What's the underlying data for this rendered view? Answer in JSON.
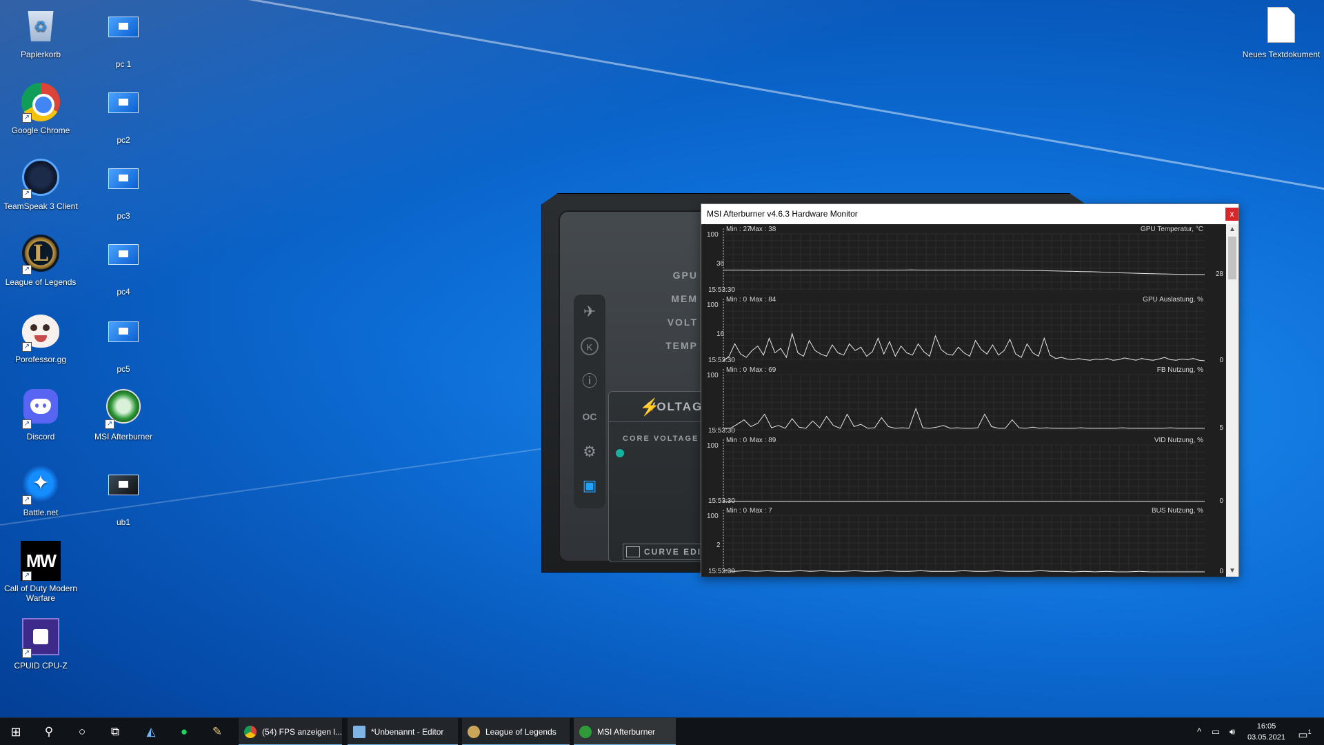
{
  "desktop": {
    "icons": [
      {
        "label": "Papierkorb",
        "icon": "recycle-bin-icon"
      },
      {
        "label": "pc 1",
        "icon": "remote-desktop-icon"
      },
      {
        "label": "Google Chrome",
        "icon": "chrome-icon"
      },
      {
        "label": "pc2",
        "icon": "remote-desktop-icon"
      },
      {
        "label": "TeamSpeak 3 Client",
        "icon": "teamspeak-icon"
      },
      {
        "label": "pc3",
        "icon": "remote-desktop-icon"
      },
      {
        "label": "League of Legends",
        "icon": "league-of-legends-icon"
      },
      {
        "label": "pc4",
        "icon": "remote-desktop-icon"
      },
      {
        "label": "Porofessor.gg",
        "icon": "porofessor-icon"
      },
      {
        "label": "pc5",
        "icon": "remote-desktop-icon"
      },
      {
        "label": "Discord",
        "icon": "discord-icon"
      },
      {
        "label": "MSI Afterburner",
        "icon": "msi-afterburner-icon"
      },
      {
        "label": "Battle.net",
        "icon": "battlenet-icon"
      },
      {
        "label": "ub1",
        "icon": "remote-desktop-icon"
      },
      {
        "label": "Call of Duty Modern Warfare",
        "icon": "modern-warfare-icon"
      },
      {
        "label": "CPUID CPU-Z",
        "icon": "cpuz-icon"
      },
      {
        "label": "Neues Textdokument",
        "icon": "text-document-icon"
      }
    ]
  },
  "afterburner": {
    "labels": {
      "gpu": "GPU",
      "mem": "MEM",
      "volt": "VOLT",
      "temp": "TEMP"
    },
    "voltage_title": "VOLTAG",
    "core_voltage": "CORE VOLTAGE",
    "curve_editor": "CURVE EDI",
    "sidebar_icons": [
      "msi-logo-icon",
      "kombustor-icon",
      "info-icon",
      "oc-scanner-icon",
      "gear-icon",
      "monitor-icon"
    ]
  },
  "hwmon": {
    "title": "MSI Afterburner v4.6.3 Hardware Monitor",
    "close": "x",
    "scroll_up": "▲",
    "scroll_down": "▼",
    "graphs": [
      {
        "name": "GPU Temperatur, °C",
        "min": "Min : 27",
        "max": "Max : 38",
        "ymax": "100",
        "ylabel_value": "36",
        "current": "28",
        "time": "15:53:30",
        "values": [
          36,
          36,
          36,
          36,
          35.5,
          36,
          36,
          36,
          35.8,
          36,
          36,
          36,
          36,
          36,
          36,
          35.7,
          36,
          36,
          36,
          36,
          36,
          36,
          36,
          36.2,
          36,
          36,
          36,
          36,
          36,
          36,
          36,
          36,
          36,
          36,
          36,
          36,
          35.6,
          35.4,
          35.2,
          35,
          34.6,
          34.3,
          34,
          33.6,
          33.3,
          33,
          32.5,
          32,
          31.5,
          31,
          30.6,
          30.2,
          29.8,
          29.4,
          29.1,
          28.8,
          28.5,
          28.3,
          28.1,
          28
        ]
      },
      {
        "name": "GPU Auslastung, %",
        "min": "Min : 0",
        "max": "Max : 84",
        "ymax": "100",
        "ylabel_value": "16",
        "current": "0",
        "time": "15:53:30",
        "values": [
          0,
          8,
          30,
          12,
          6,
          18,
          26,
          10,
          40,
          14,
          22,
          6,
          48,
          14,
          8,
          36,
          18,
          12,
          8,
          28,
          14,
          10,
          30,
          18,
          24,
          8,
          16,
          40,
          12,
          34,
          8,
          26,
          14,
          10,
          30,
          16,
          8,
          44,
          20,
          12,
          10,
          24,
          14,
          8,
          36,
          20,
          12,
          28,
          10,
          18,
          38,
          12,
          6,
          30,
          14,
          8,
          40,
          10,
          4,
          6,
          3,
          2,
          4,
          2,
          1,
          3,
          2,
          4,
          1,
          2,
          5,
          3,
          1,
          4,
          2,
          1,
          3,
          6,
          2,
          1,
          3,
          2,
          4,
          1,
          0
        ]
      },
      {
        "name": "FB Nutzung, %",
        "min": "Min : 0",
        "max": "Max : 69",
        "ymax": "100",
        "ylabel_value": "",
        "current": "5",
        "time": "15:53:30",
        "values": [
          5,
          5,
          12,
          20,
          8,
          14,
          30,
          6,
          10,
          5,
          22,
          7,
          5,
          18,
          6,
          26,
          10,
          5,
          30,
          8,
          12,
          5,
          6,
          24,
          8,
          5,
          6,
          5,
          40,
          6,
          5,
          7,
          10,
          5,
          6,
          5,
          5,
          6,
          30,
          8,
          5,
          5,
          20,
          6,
          5,
          7,
          5,
          6,
          5,
          5,
          5,
          5,
          6,
          5,
          5,
          5,
          5,
          5,
          6,
          5,
          5,
          5,
          5,
          5,
          5,
          6,
          5,
          5,
          5,
          5,
          5
        ]
      },
      {
        "name": "VID Nutzung, %",
        "min": "Min : 0",
        "max": "Max : 89",
        "ymax": "100",
        "ylabel_value": "",
        "current": "0",
        "time": "15:53:30",
        "values": [
          0,
          0,
          0,
          0,
          0,
          0,
          0,
          0,
          0,
          0,
          0,
          0,
          0,
          0,
          0,
          0,
          0,
          0,
          0,
          0
        ]
      },
      {
        "name": "BUS Nutzung, %",
        "min": "Min : 0",
        "max": "Max : 7",
        "ymax": "100",
        "ylabel_value": "2",
        "current": "0",
        "time": "15:53:30",
        "values": [
          2,
          1,
          2,
          1,
          2,
          1,
          1,
          2,
          1,
          2,
          1,
          1,
          2,
          1,
          1,
          2,
          1,
          1,
          2,
          1,
          1,
          1,
          2,
          1,
          1,
          2,
          1,
          1,
          1,
          2,
          1,
          1,
          0,
          1,
          0,
          1,
          0,
          0,
          1,
          0,
          0,
          0,
          0,
          0,
          0
        ]
      }
    ]
  },
  "taskbar": {
    "start_icon": "windows-start-icon",
    "search_icon": "search-icon",
    "cortana_icon": "cortana-icon",
    "taskview_icon": "task-view-icon",
    "tasks": [
      {
        "label": "(54) FPS anzeigen l...",
        "icon": "chrome-icon",
        "color": "#db4437"
      },
      {
        "label": "*Unbenannt - Editor",
        "icon": "notepad-icon",
        "color": "#7fb5e6"
      },
      {
        "label": "League of Legends",
        "icon": "league-of-legends-icon",
        "color": "#c9a55a"
      },
      {
        "label": "MSI Afterburner",
        "icon": "msi-afterburner-icon",
        "color": "#2f9a38"
      }
    ],
    "time": "16:05",
    "date": "03.05.2021",
    "notification_count": "1"
  }
}
